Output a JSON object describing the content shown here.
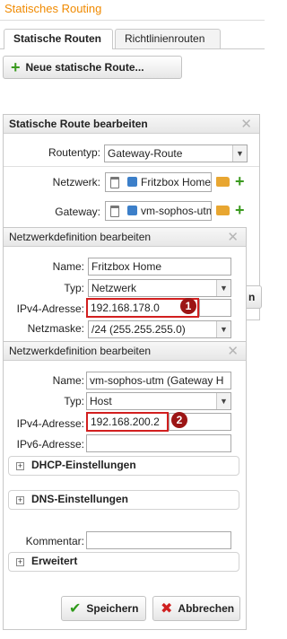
{
  "header": {
    "title": "Statisches Routing"
  },
  "tabs": [
    {
      "label": "Statische Routen"
    },
    {
      "label": "Richtlinienrouten"
    }
  ],
  "toolbar": {
    "new_route_label": "Neue statische Route..."
  },
  "route_panel": {
    "title": "Statische Route bearbeiten",
    "routentyp_label": "Routentyp:",
    "routentyp_value": "Gateway-Route",
    "netzwerk_label": "Netzwerk:",
    "netzwerk_value": "Fritzbox Home",
    "gateway_label": "Gateway:",
    "gateway_value": "vm-sophos-utm",
    "hidden_button_fragment": "n"
  },
  "net_dialog": {
    "title": "Netzwerkdefinition bearbeiten",
    "name_label": "Name:",
    "name_value": "Fritzbox Home",
    "typ_label": "Typ:",
    "typ_value": "Netzwerk",
    "ipv4_label": "IPv4-Adresse:",
    "ipv4_value": "192.168.178.0",
    "badge": "1",
    "netmask_label": "Netzmaske:",
    "netmask_value": "/24 (255.255.255.0)"
  },
  "host_dialog": {
    "title": "Netzwerkdefinition bearbeiten",
    "name_label": "Name:",
    "name_value": "vm-sophos-utm (Gateway H",
    "typ_label": "Typ:",
    "typ_value": "Host",
    "ipv4_label": "IPv4-Adresse:",
    "ipv4_value": "192.168.200.2",
    "badge": "2",
    "ipv6_label": "IPv6-Adresse:",
    "ipv6_value": "",
    "dhcp_section": "DHCP-Einstellungen",
    "dns_section": "DNS-Einstellungen",
    "kommentar_label": "Kommentar:",
    "kommentar_value": "",
    "erweitert_section": "Erweitert",
    "save_label": "Speichern",
    "cancel_label": "Abbrechen"
  },
  "colors": {
    "header_accent": "#f08a00",
    "highlight_border": "#d21f1f",
    "badge_bg": "#9c1515",
    "plus_green": "#3b9a1f"
  }
}
